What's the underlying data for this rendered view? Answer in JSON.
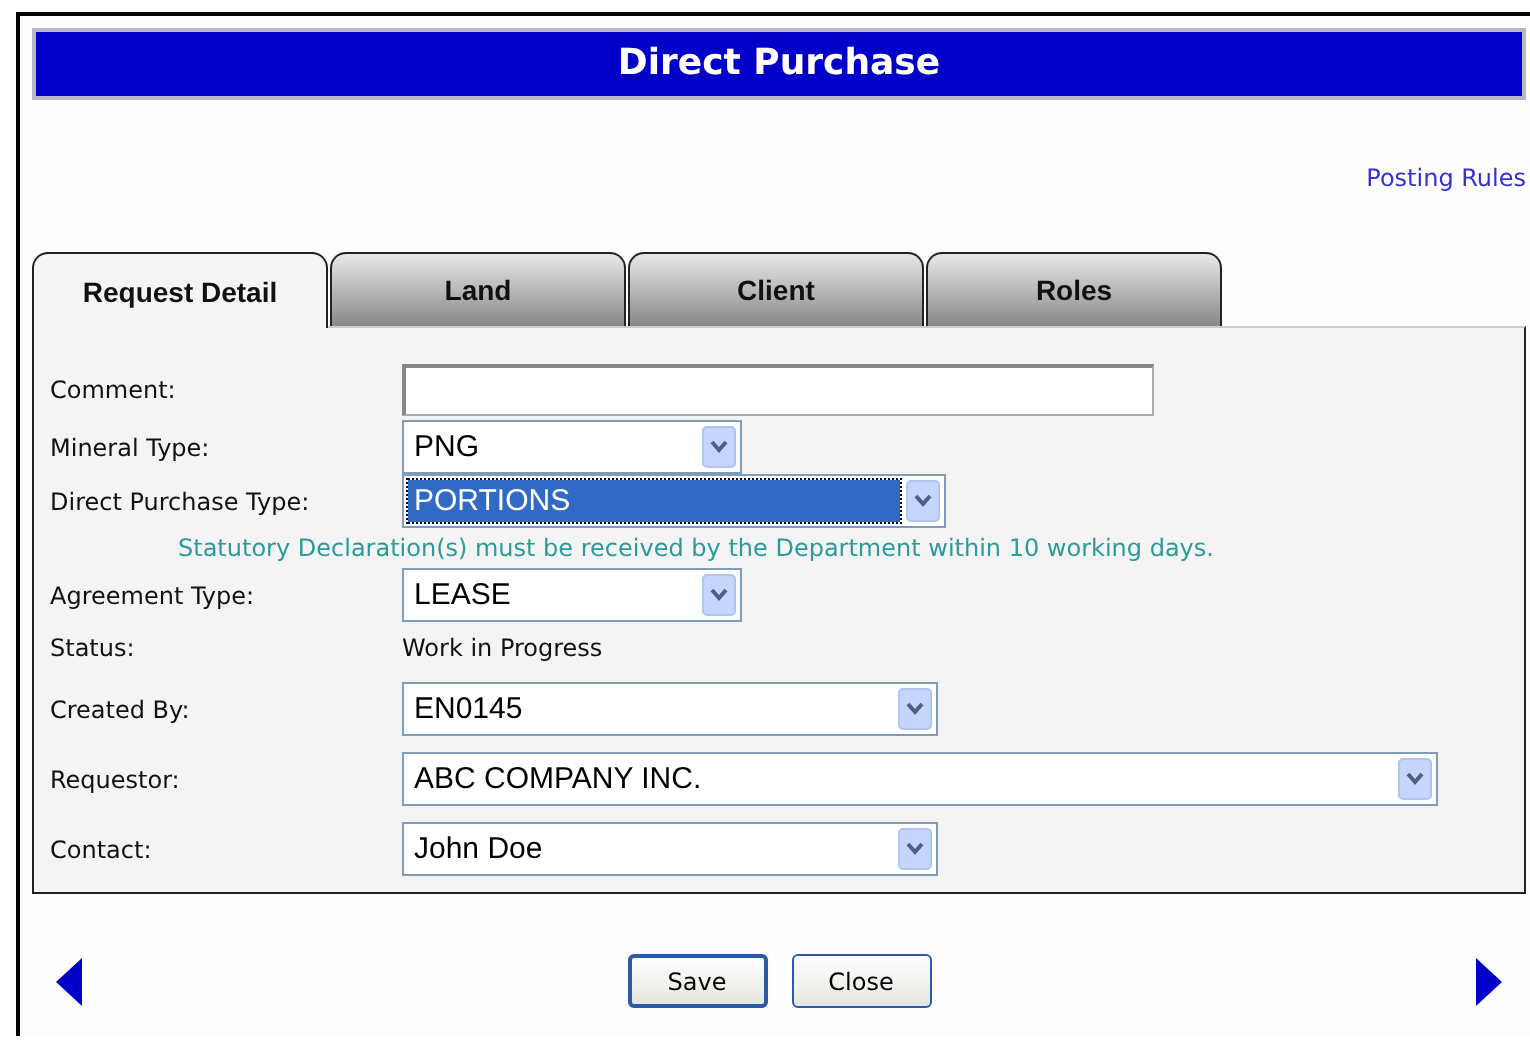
{
  "window": {
    "title": "Direct Purchase"
  },
  "posting_rules_link": "Posting Rules",
  "tabs": [
    {
      "label": "Request Detail",
      "selected": true
    },
    {
      "label": "Land",
      "selected": false
    },
    {
      "label": "Client",
      "selected": false
    },
    {
      "label": "Roles",
      "selected": false
    }
  ],
  "fields": [
    {
      "kind": "text",
      "label": "Comment:"
    },
    {
      "kind": "select",
      "label": "Mineral Type:",
      "value": "PNG",
      "highlighted": false
    },
    {
      "kind": "select",
      "label": "Direct Purchase Type:",
      "value": "PORTIONS",
      "highlighted": true
    },
    {
      "kind": "note",
      "text": "Statutory Declaration(s) must be received by the Department within 10 working days."
    },
    {
      "kind": "select",
      "label": "Agreement Type:",
      "value": "LEASE",
      "highlighted": false
    },
    {
      "kind": "static",
      "label": "Status:",
      "value": "Work in Progress"
    },
    {
      "kind": "select",
      "label": "Created By:",
      "value": "EN0145",
      "highlighted": false
    },
    {
      "kind": "select",
      "label": "Requestor:",
      "value": "ABC COMPANY INC.",
      "highlighted": false
    },
    {
      "kind": "select",
      "label": "Contact:",
      "value": "John Doe",
      "highlighted": false
    }
  ],
  "buttons": [
    {
      "label": "Save",
      "default": true
    },
    {
      "label": "Close",
      "default": false
    }
  ]
}
